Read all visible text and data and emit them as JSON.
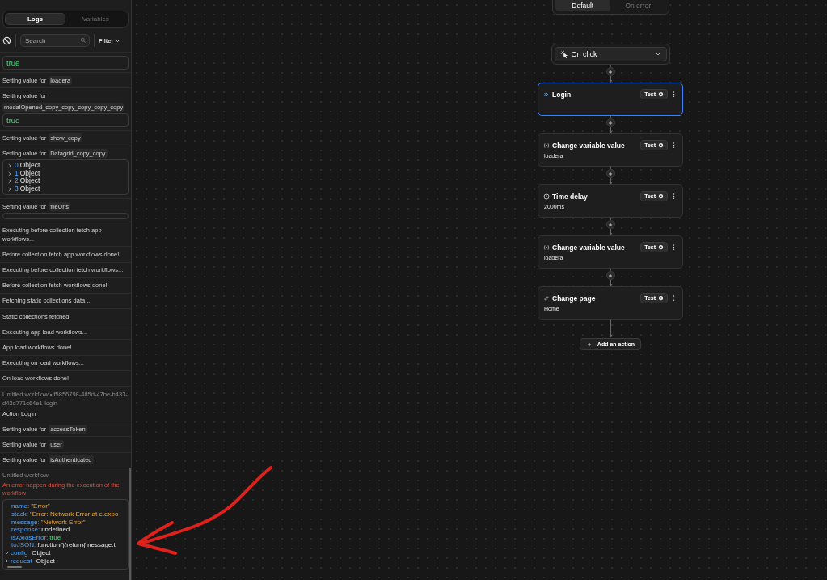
{
  "sidebar": {
    "tabs": [
      {
        "label": "Logs",
        "selected": true
      },
      {
        "label": "Variables",
        "selected": false
      }
    ],
    "search": {
      "placeholder": "Search"
    },
    "filter": {
      "label": "Filter"
    },
    "logs": [
      {
        "kind": "value",
        "text": "true"
      },
      {
        "kind": "setting",
        "text": "Setting value for",
        "chip": "loadera"
      },
      {
        "kind": "setting",
        "text": "Setting value for",
        "chip": "modalOpened_copy_copy_copy_copy_copy",
        "value": "true"
      },
      {
        "kind": "setting",
        "text": "Setting value for",
        "chip": "show_copy"
      },
      {
        "kind": "setting",
        "text": "Setting value for",
        "chip": "Datagrid_copy_copy",
        "tree": [
          {
            "key": "0",
            "value": "Object"
          },
          {
            "key": "1",
            "value": "Object"
          },
          {
            "key": "2",
            "value": "Object"
          },
          {
            "key": "3",
            "value": "Object"
          }
        ]
      },
      {
        "kind": "setting",
        "text": "Setting value for",
        "chip": "fileUrls",
        "empty_box": true
      },
      {
        "kind": "message",
        "text": "Executing before collection fetch app workflows..."
      },
      {
        "kind": "message",
        "text": "Before collection fetch app workflows done!"
      },
      {
        "kind": "message",
        "text": "Executing before collection fetch workflows..."
      },
      {
        "kind": "message",
        "text": "Before collection fetch workflows done!"
      },
      {
        "kind": "message",
        "text": "Fetching static collections data..."
      },
      {
        "kind": "message",
        "text": "Static collections fetched!"
      },
      {
        "kind": "message",
        "text": "Executing app load workflows..."
      },
      {
        "kind": "message",
        "text": "App load workflows done!"
      },
      {
        "kind": "message",
        "text": "Executing on load workflows..."
      },
      {
        "kind": "message",
        "text": "On load workflows done!"
      },
      {
        "kind": "workflow",
        "text": "Untitled workflow • f5856798-485d-47be-b433-d43d771c64e1-login",
        "action": "Action Login"
      },
      {
        "kind": "setting",
        "text": "Setting value for",
        "chip": "accessToken"
      },
      {
        "kind": "setting",
        "text": "Setting value for",
        "chip": "user"
      },
      {
        "kind": "setting",
        "text": "Setting value for",
        "chip": "isAuthenticated"
      },
      {
        "kind": "error",
        "text": "Untitled workflow",
        "error": "An error happen during the execution of the workflow",
        "props": [
          {
            "key": "name:",
            "value": "\"Error\"",
            "kind": "string",
            "expandable": false
          },
          {
            "key": "stack:",
            "value": "\"Error: Network Error at e.expo",
            "kind": "string",
            "expandable": false
          },
          {
            "key": "message:",
            "value": "\"Network Error\"",
            "kind": "string",
            "expandable": false
          },
          {
            "key": "response:",
            "value": "undefined",
            "kind": "plain",
            "expandable": false
          },
          {
            "key": "isAxiosError:",
            "value": "true",
            "kind": "boolean",
            "expandable": false
          },
          {
            "key": "toJSON:",
            "value": "function(){return{message:t",
            "kind": "plain",
            "expandable": false
          },
          {
            "key": "config",
            "value": "Object",
            "kind": "plain",
            "expandable": true
          },
          {
            "key": "request",
            "value": "Object",
            "kind": "plain",
            "expandable": true
          }
        ]
      }
    ]
  },
  "canvas": {
    "modes": [
      {
        "label": "Default",
        "selected": true
      },
      {
        "label": "On error",
        "selected": false
      }
    ],
    "trigger": {
      "label": "On click"
    },
    "steps": [
      {
        "kind": "login",
        "title": "Login",
        "selected": true,
        "button": "Test"
      },
      {
        "kind": "variable",
        "title": "Change variable value",
        "subtitle": "loadera",
        "selected": false,
        "button": "Test"
      },
      {
        "kind": "delay",
        "title": "Time delay",
        "subtitle": "2000ms",
        "selected": false,
        "button": "Test"
      },
      {
        "kind": "variable",
        "title": "Change variable value",
        "subtitle": "loadera",
        "selected": false,
        "button": "Test"
      },
      {
        "kind": "page",
        "title": "Change page",
        "subtitle": "Home",
        "selected": false,
        "button": "Test"
      }
    ],
    "add_action": {
      "label": "Add an action"
    }
  },
  "annotation": {
    "kind": "arrow"
  }
}
